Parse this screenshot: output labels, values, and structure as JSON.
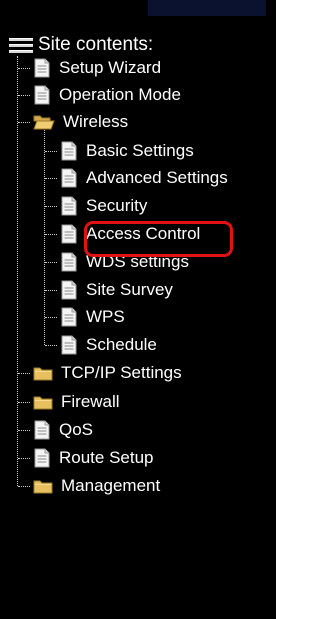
{
  "tree": {
    "root_label": "Site contents:",
    "items": [
      {
        "label": "Setup Wizard",
        "icon": "page-icon"
      },
      {
        "label": "Operation Mode",
        "icon": "page-icon"
      },
      {
        "label": "Wireless",
        "icon": "open-folder-icon",
        "children": [
          {
            "label": "Basic Settings",
            "icon": "page-icon"
          },
          {
            "label": "Advanced Settings",
            "icon": "page-icon"
          },
          {
            "label": "Security",
            "icon": "page-icon"
          },
          {
            "label": "Access Control",
            "icon": "page-icon"
          },
          {
            "label": "WDS settings",
            "icon": "page-icon",
            "highlighted": true
          },
          {
            "label": "Site Survey",
            "icon": "page-icon"
          },
          {
            "label": "WPS",
            "icon": "page-icon"
          },
          {
            "label": "Schedule",
            "icon": "page-icon"
          }
        ]
      },
      {
        "label": "TCP/IP Settings",
        "icon": "folder-icon"
      },
      {
        "label": "Firewall",
        "icon": "folder-icon"
      },
      {
        "label": "QoS",
        "icon": "page-icon"
      },
      {
        "label": "Route Setup",
        "icon": "page-icon"
      },
      {
        "label": "Management",
        "icon": "folder-icon"
      }
    ]
  },
  "colors": {
    "background": "#000000",
    "text": "#ffffff",
    "highlight": "#e31212",
    "folder": "#e8c060"
  }
}
